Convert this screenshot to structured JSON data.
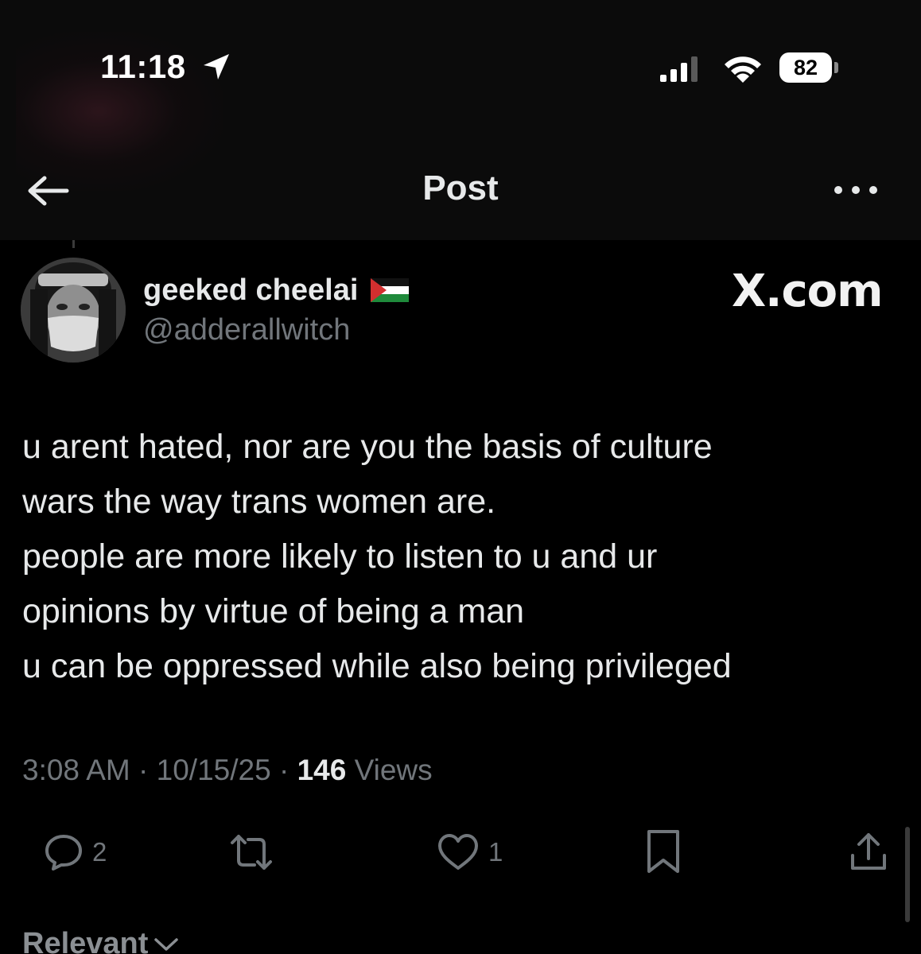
{
  "status_bar": {
    "time": "11:18",
    "battery": "82"
  },
  "nav": {
    "title": "Post"
  },
  "post": {
    "author": {
      "display_name": "geeked cheelai",
      "handle": "@adderallwitch"
    },
    "brand": "X.com",
    "lines": [
      "u arent hated, nor are you the basis of culture",
      "wars the way trans women are.",
      "people are more likely to listen to u and ur",
      "opinions by virtue of being a man",
      "u can be oppressed while also being privileged"
    ],
    "time": "3:08 AM",
    "separator": "·",
    "date": "10/15/25",
    "views_count": "146",
    "views_label": "Views",
    "replies": "2",
    "likes": "1"
  },
  "sort": {
    "label": "Relevant"
  },
  "colors": {
    "background": "#000000",
    "text": "#e7e9ea",
    "secondary_text": "#71767b"
  }
}
